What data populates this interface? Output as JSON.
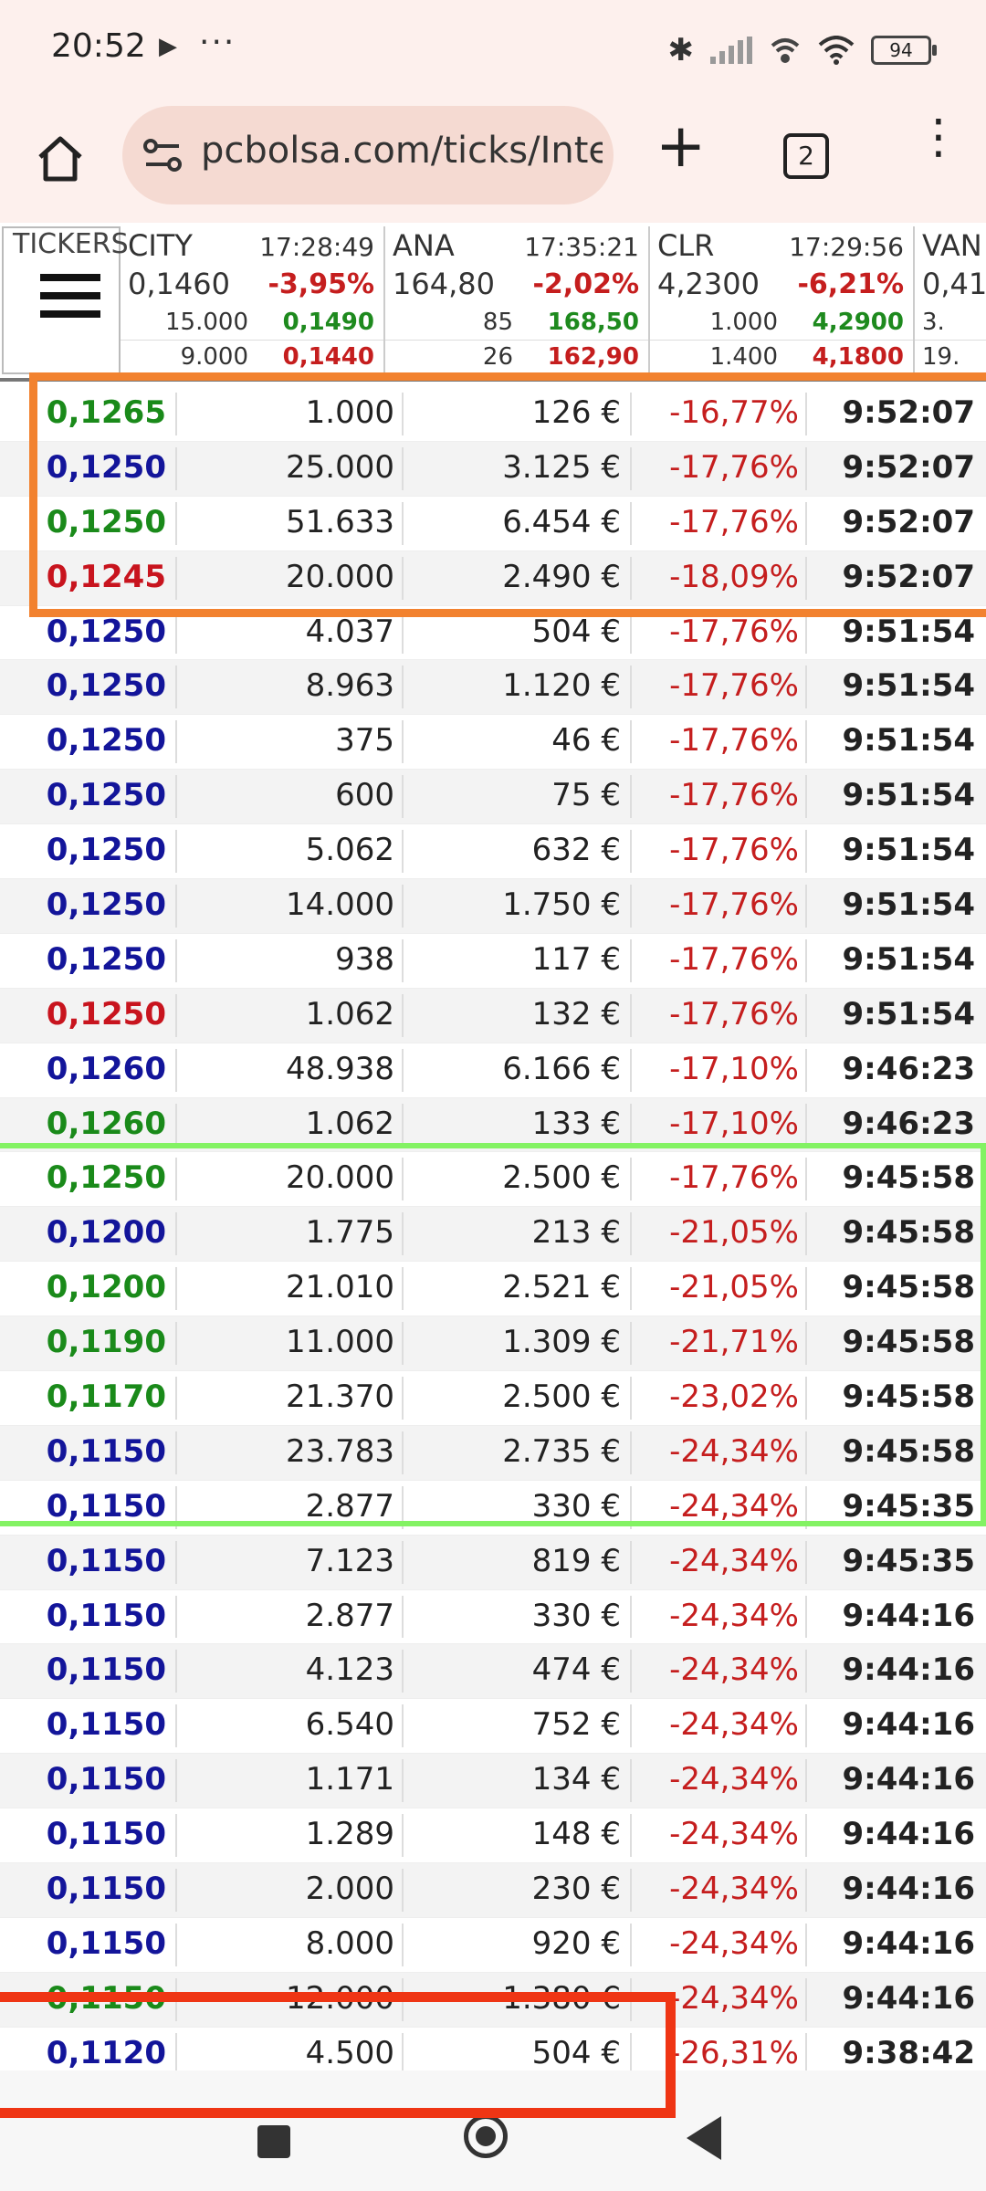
{
  "status_bar": {
    "time": "20:52",
    "battery": "94"
  },
  "browser": {
    "url": "pcbolsa.com/ticks/Inte",
    "tab_count": "2"
  },
  "tickers": {
    "label": "TICKERS",
    "items": [
      {
        "symbol": "CITY",
        "time": "17:28:49",
        "price": "0,1460",
        "change": "-3,95%",
        "bid_qty": "15.000",
        "bid": "0,1490",
        "ask_qty": "9.000",
        "ask": "0,1440"
      },
      {
        "symbol": "ANA",
        "time": "17:35:21",
        "price": "164,80",
        "change": "-2,02%",
        "bid_qty": "85",
        "bid": "168,50",
        "ask_qty": "26",
        "ask": "162,90"
      },
      {
        "symbol": "CLR",
        "time": "17:29:56",
        "price": "4,2300",
        "change": "-6,21%",
        "bid_qty": "1.000",
        "bid": "4,2900",
        "ask_qty": "1.400",
        "ask": "4,1800"
      },
      {
        "symbol": "VAN",
        "time": "",
        "price": "0,41",
        "change": "",
        "bid_qty": "3.",
        "bid": "",
        "ask_qty": "19.",
        "ask": ""
      }
    ]
  },
  "ticks": [
    {
      "price": "0,1265",
      "color": "green",
      "qty": "1.000",
      "amount": "126 €",
      "pct": "-16,77%",
      "time": "9:52:07"
    },
    {
      "price": "0,1250",
      "color": "blue",
      "qty": "25.000",
      "amount": "3.125 €",
      "pct": "-17,76%",
      "time": "9:52:07"
    },
    {
      "price": "0,1250",
      "color": "green",
      "qty": "51.633",
      "amount": "6.454 €",
      "pct": "-17,76%",
      "time": "9:52:07"
    },
    {
      "price": "0,1245",
      "color": "red",
      "qty": "20.000",
      "amount": "2.490 €",
      "pct": "-18,09%",
      "time": "9:52:07"
    },
    {
      "price": "0,1250",
      "color": "blue",
      "qty": "4.037",
      "amount": "504 €",
      "pct": "-17,76%",
      "time": "9:51:54"
    },
    {
      "price": "0,1250",
      "color": "blue",
      "qty": "8.963",
      "amount": "1.120 €",
      "pct": "-17,76%",
      "time": "9:51:54"
    },
    {
      "price": "0,1250",
      "color": "blue",
      "qty": "375",
      "amount": "46 €",
      "pct": "-17,76%",
      "time": "9:51:54"
    },
    {
      "price": "0,1250",
      "color": "blue",
      "qty": "600",
      "amount": "75 €",
      "pct": "-17,76%",
      "time": "9:51:54"
    },
    {
      "price": "0,1250",
      "color": "blue",
      "qty": "5.062",
      "amount": "632 €",
      "pct": "-17,76%",
      "time": "9:51:54"
    },
    {
      "price": "0,1250",
      "color": "blue",
      "qty": "14.000",
      "amount": "1.750 €",
      "pct": "-17,76%",
      "time": "9:51:54"
    },
    {
      "price": "0,1250",
      "color": "blue",
      "qty": "938",
      "amount": "117 €",
      "pct": "-17,76%",
      "time": "9:51:54"
    },
    {
      "price": "0,1250",
      "color": "red",
      "qty": "1.062",
      "amount": "132 €",
      "pct": "-17,76%",
      "time": "9:51:54"
    },
    {
      "price": "0,1260",
      "color": "blue",
      "qty": "48.938",
      "amount": "6.166 €",
      "pct": "-17,10%",
      "time": "9:46:23"
    },
    {
      "price": "0,1260",
      "color": "green",
      "qty": "1.062",
      "amount": "133 €",
      "pct": "-17,10%",
      "time": "9:46:23"
    },
    {
      "price": "0,1250",
      "color": "green",
      "qty": "20.000",
      "amount": "2.500 €",
      "pct": "-17,76%",
      "time": "9:45:58"
    },
    {
      "price": "0,1200",
      "color": "blue",
      "qty": "1.775",
      "amount": "213 €",
      "pct": "-21,05%",
      "time": "9:45:58"
    },
    {
      "price": "0,1200",
      "color": "green",
      "qty": "21.010",
      "amount": "2.521 €",
      "pct": "-21,05%",
      "time": "9:45:58"
    },
    {
      "price": "0,1190",
      "color": "green",
      "qty": "11.000",
      "amount": "1.309 €",
      "pct": "-21,71%",
      "time": "9:45:58"
    },
    {
      "price": "0,1170",
      "color": "green",
      "qty": "21.370",
      "amount": "2.500 €",
      "pct": "-23,02%",
      "time": "9:45:58"
    },
    {
      "price": "0,1150",
      "color": "blue",
      "qty": "23.783",
      "amount": "2.735 €",
      "pct": "-24,34%",
      "time": "9:45:58"
    },
    {
      "price": "0,1150",
      "color": "blue",
      "qty": "2.877",
      "amount": "330 €",
      "pct": "-24,34%",
      "time": "9:45:35"
    },
    {
      "price": "0,1150",
      "color": "blue",
      "qty": "7.123",
      "amount": "819 €",
      "pct": "-24,34%",
      "time": "9:45:35"
    },
    {
      "price": "0,1150",
      "color": "blue",
      "qty": "2.877",
      "amount": "330 €",
      "pct": "-24,34%",
      "time": "9:44:16"
    },
    {
      "price": "0,1150",
      "color": "blue",
      "qty": "4.123",
      "amount": "474 €",
      "pct": "-24,34%",
      "time": "9:44:16"
    },
    {
      "price": "0,1150",
      "color": "blue",
      "qty": "6.540",
      "amount": "752 €",
      "pct": "-24,34%",
      "time": "9:44:16"
    },
    {
      "price": "0,1150",
      "color": "blue",
      "qty": "1.171",
      "amount": "134 €",
      "pct": "-24,34%",
      "time": "9:44:16"
    },
    {
      "price": "0,1150",
      "color": "blue",
      "qty": "1.289",
      "amount": "148 €",
      "pct": "-24,34%",
      "time": "9:44:16"
    },
    {
      "price": "0,1150",
      "color": "blue",
      "qty": "2.000",
      "amount": "230 €",
      "pct": "-24,34%",
      "time": "9:44:16"
    },
    {
      "price": "0,1150",
      "color": "blue",
      "qty": "8.000",
      "amount": "920 €",
      "pct": "-24,34%",
      "time": "9:44:16"
    },
    {
      "price": "0,1150",
      "color": "green",
      "qty": "12.000",
      "amount": "1.380 €",
      "pct": "-24,34%",
      "time": "9:44:16"
    },
    {
      "price": "0,1120",
      "color": "blue",
      "qty": "4.500",
      "amount": "504 €",
      "pct": "-26,31%",
      "time": "9:38:42"
    }
  ],
  "colors": {
    "green": "#1a8a1a",
    "blue": "#13159a",
    "red": "#c8141e",
    "highlight_orange": "#f2822f",
    "highlight_green": "#83f263",
    "highlight_red": "#ef3514"
  }
}
